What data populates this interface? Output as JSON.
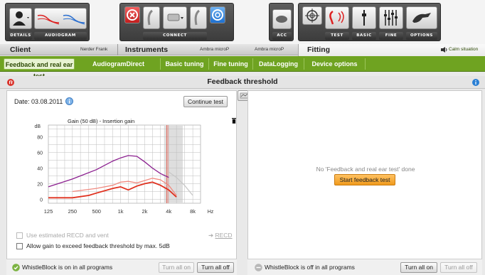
{
  "toolbar": {
    "details_label": "DETAILS",
    "audiogram_label": "AUDIOGRAM",
    "connect_label": "CONNECT",
    "acc_label": "ACC",
    "test_label": "TEST",
    "basic_label": "BASIC",
    "fine_label": "FINE",
    "options_label": "OPTIONS"
  },
  "sections": {
    "client": {
      "title": "Client",
      "value": "Nerder Frank"
    },
    "instruments": {
      "title": "Instruments",
      "left_value": "Ambra microP",
      "right_value": "Ambra microP"
    },
    "fitting": {
      "title": "Fitting",
      "situation": "Calm situation"
    }
  },
  "tabs": [
    {
      "label": "Feedback and real ear test",
      "active": true
    },
    {
      "label": "AudiogramDirect",
      "active": false
    },
    {
      "label": "Basic tuning",
      "active": false
    },
    {
      "label": "Fine tuning",
      "active": false
    },
    {
      "label": "DataLogging",
      "active": false
    },
    {
      "label": "Device options",
      "active": false
    }
  ],
  "page_title": "Feedback threshold",
  "left_panel": {
    "date_label": "Date: 03.08.2011",
    "continue_button": "Continue test",
    "chart_title": "Gain (50 dB) - Insertion gain",
    "recd_checkbox": "Use estimated RECD and vent",
    "recd_link": "RECD",
    "allow_gain_checkbox": "Allow gain to exceed feedback threshold by max. 5dB"
  },
  "right_panel": {
    "no_test_text": "No 'Feedback and real ear test' done",
    "start_button": "Start feedback test"
  },
  "whistleblock_left": {
    "status": "WhistleBlock is on in all programs",
    "turn_on": "Turn all on",
    "turn_off": "Turn all off"
  },
  "whistleblock_right": {
    "status": "WhistleBlock is off in all programs",
    "turn_on": "Turn all on",
    "turn_off": "Turn all off"
  },
  "colors": {
    "accent_green": "#6fa321",
    "purple_curve": "#8b1f8f",
    "red_curve": "#e0301e",
    "pink_curve": "#f08a80",
    "start_button": "#f5a623",
    "info_blue": "#2a7fd4"
  },
  "chart_data": {
    "type": "line",
    "title": "Gain (50 dB) - Insertion gain",
    "ylabel": "dB",
    "xlabel": "Hz",
    "x_ticks": [
      "125",
      "250",
      "500",
      "1k",
      "2k",
      "4k",
      "8k"
    ],
    "y_ticks": [
      0,
      20,
      40,
      60,
      80
    ],
    "ylim": [
      -5,
      95
    ],
    "x_scale": "log",
    "xlim": [
      125,
      10000
    ],
    "series": [
      {
        "color": "#8b1f8f",
        "x": [
          125,
          250,
          500,
          800,
          1000,
          1250,
          1600,
          2000,
          2500,
          3150,
          4000
        ],
        "y": [
          16,
          26,
          38,
          49,
          53,
          56,
          55,
          48,
          40,
          33,
          28
        ]
      },
      {
        "color": "#f08a80",
        "x": [
          250,
          500,
          800,
          1000,
          1250,
          1600,
          2000,
          2500,
          3150,
          4000,
          5000
        ],
        "y": [
          10,
          14,
          18,
          22,
          23,
          21,
          24,
          27,
          25,
          18,
          5
        ]
      },
      {
        "color": "#e0301e",
        "x": [
          125,
          250,
          400,
          500,
          800,
          1000,
          1250,
          1600,
          2000,
          2500,
          3150,
          4000,
          5000
        ],
        "y": [
          2,
          2,
          5,
          8,
          14,
          16,
          12,
          17,
          20,
          22,
          18,
          12,
          3
        ]
      },
      {
        "color": "#c8c8c8",
        "x": [
          4000,
          5000,
          6300,
          8000
        ],
        "y": [
          35,
          28,
          18,
          5
        ]
      }
    ],
    "grid": true
  }
}
